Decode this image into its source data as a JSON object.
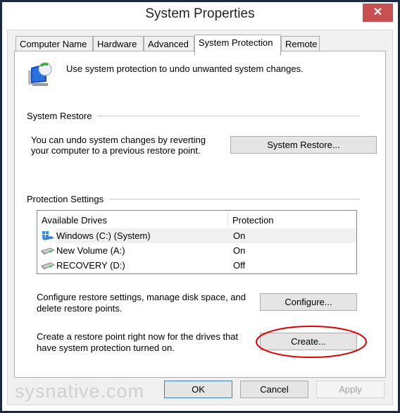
{
  "window": {
    "title": "System Properties",
    "close_icon": "close-icon"
  },
  "tabs": [
    {
      "label": "Computer Name"
    },
    {
      "label": "Hardware"
    },
    {
      "label": "Advanced"
    },
    {
      "label": "System Protection",
      "selected": true
    },
    {
      "label": "Remote"
    }
  ],
  "intro": "Use system protection to undo unwanted system changes.",
  "restore": {
    "heading": "System Restore",
    "line1": "You can undo system changes by reverting",
    "line2": "your computer to a previous restore point.",
    "button": "System Restore..."
  },
  "protection": {
    "heading": "Protection Settings",
    "columns": [
      "Available Drives",
      "Protection"
    ],
    "drives": [
      {
        "name": "Windows (C:) (System)",
        "protection": "On",
        "selected": true
      },
      {
        "name": "New Volume (A:)",
        "protection": "On"
      },
      {
        "name": "RECOVERY (D:)",
        "protection": "Off"
      }
    ],
    "configure_line1": "Configure restore settings, manage disk space, and",
    "configure_line2": "delete restore points.",
    "configure_button": "Configure...",
    "create_line1": "Create a restore point right now for the drives that",
    "create_line2": "have system protection turned on.",
    "create_button": "Create..."
  },
  "footer": {
    "ok": "OK",
    "cancel": "Cancel",
    "apply": "Apply",
    "apply_disabled": true
  },
  "watermark": "sysnative.com",
  "colors": {
    "highlight_ellipse": "#e00000",
    "close": "#c75050",
    "ok_border": "#3c7fb1"
  }
}
